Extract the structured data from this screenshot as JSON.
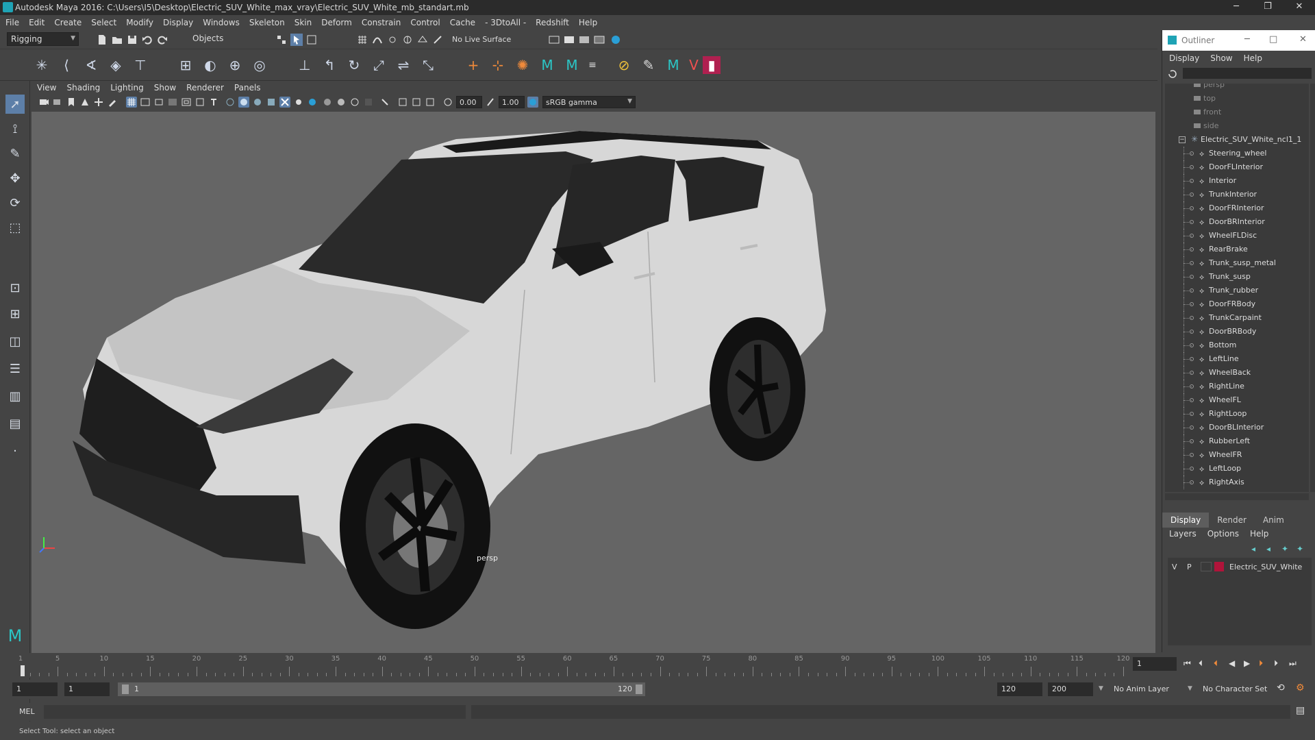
{
  "window": {
    "title": "Autodesk Maya 2016: C:\\Users\\I5\\Desktop\\Electric_SUV_White_max_vray\\Electric_SUV_White_mb_standart.mb",
    "minimize": "─",
    "maximize": "❐",
    "close": "✕"
  },
  "menubar": [
    "File",
    "Edit",
    "Create",
    "Select",
    "Modify",
    "Display",
    "Windows",
    "Skeleton",
    "Skin",
    "Deform",
    "Constrain",
    "Control",
    "Cache",
    "- 3DtoAll -",
    "Redshift",
    "Help"
  ],
  "statusline": {
    "mode": "Rigging",
    "selection_mask": "Objects",
    "live_surface": "No Live Surface"
  },
  "viewport": {
    "menu": [
      "View",
      "Shading",
      "Lighting",
      "Show",
      "Renderer",
      "Panels"
    ],
    "exposure": "0.00",
    "gamma": "1.00",
    "color_space": "sRGB gamma",
    "camera_label": "persp"
  },
  "outliner": {
    "title": "Outliner",
    "menu": [
      "Display",
      "Show",
      "Help"
    ],
    "cameras": [
      "persp",
      "top",
      "front",
      "side"
    ],
    "root": "Electric_SUV_White_ncl1_1",
    "children": [
      "Steering_wheel",
      "DoorFLInterior",
      "Interior",
      "TrunkInterior",
      "DoorFRInterior",
      "DoorBRInterior",
      "WheelFLDisc",
      "RearBrake",
      "Trunk_susp_metal",
      "Trunk_susp",
      "Trunk_rubber",
      "DoorFRBody",
      "TrunkCarpaint",
      "DoorBRBody",
      "Bottom",
      "LeftLine",
      "WheelBack",
      "RightLine",
      "WheelFL",
      "RightLoop",
      "DoorBLInterior",
      "RubberLeft",
      "WheelFR",
      "LeftLoop",
      "RightAxis"
    ]
  },
  "layers": {
    "tabs": [
      "Display",
      "Render",
      "Anim"
    ],
    "active_tab": "Display",
    "menu": [
      "Layers",
      "Options",
      "Help"
    ],
    "rows": [
      {
        "v": "V",
        "p": "P",
        "name": "Electric_SUV_White",
        "color": "#b0143a"
      }
    ]
  },
  "timeline": {
    "ticks": [
      "1",
      "5",
      "10",
      "15",
      "20",
      "25",
      "30",
      "35",
      "40",
      "45",
      "50",
      "55",
      "60",
      "65",
      "70",
      "75",
      "80",
      "85",
      "90",
      "95",
      "100",
      "105",
      "110",
      "115",
      "120"
    ],
    "current_frame": "1"
  },
  "range": {
    "start": "1",
    "current": "1",
    "range_start": "1",
    "range_end": "120",
    "end": "120",
    "max_end": "200",
    "anim_layer": "No Anim Layer",
    "character_set": "No Character Set"
  },
  "command": {
    "language": "MEL"
  },
  "help": {
    "text": "Select Tool: select an object"
  },
  "colors": {
    "viewport_bg": "#656565",
    "panel_bg": "#444444",
    "accent": "#1fa3b5",
    "layer_color": "#b0143a"
  }
}
